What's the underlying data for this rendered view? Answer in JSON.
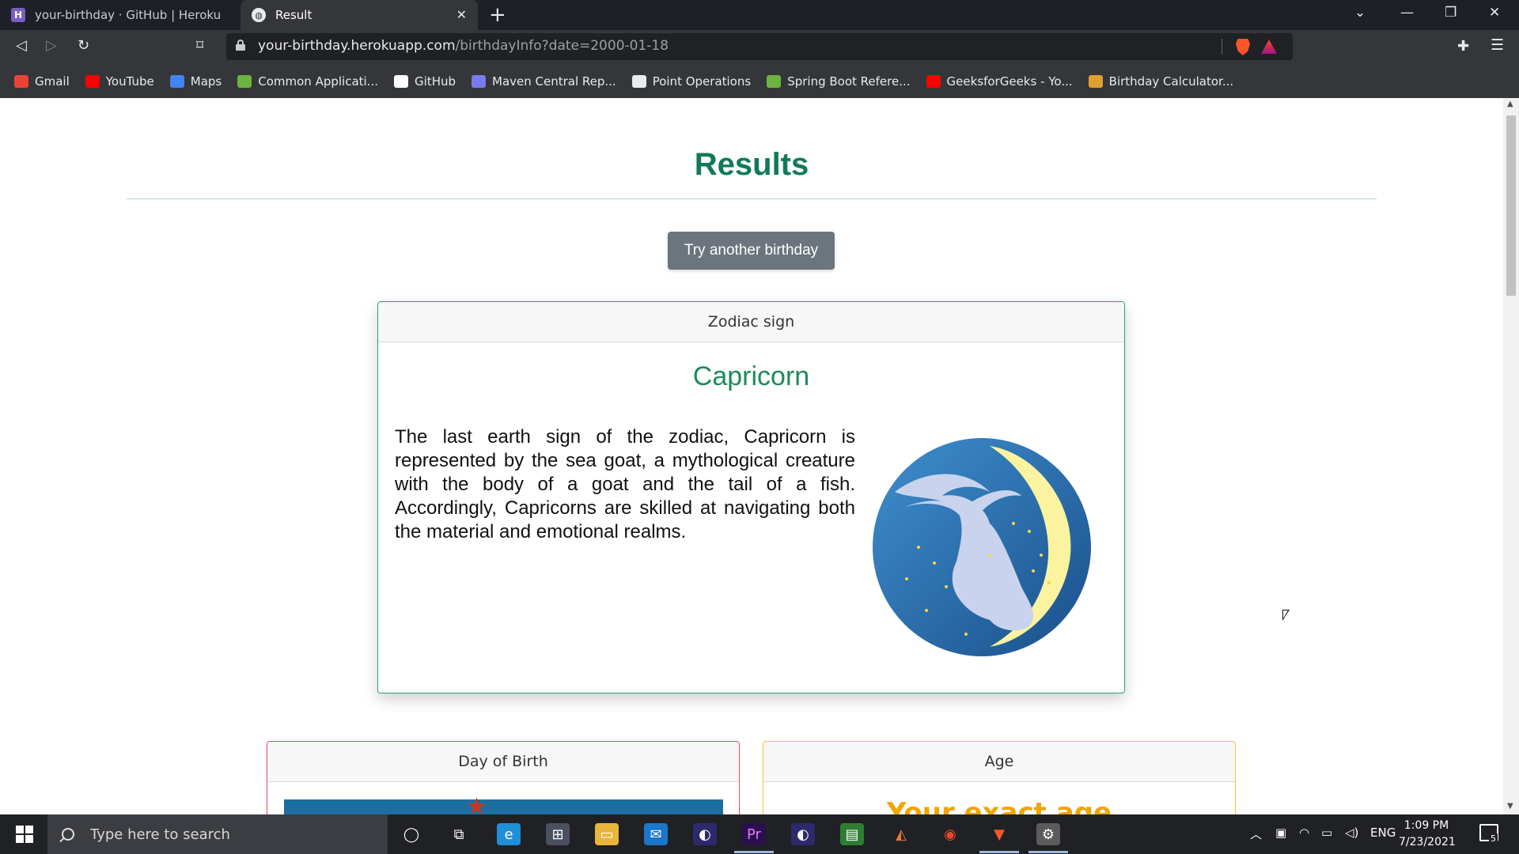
{
  "browser": {
    "tabs": [
      {
        "title": "your-birthday · GitHub | Heroku",
        "active": false
      },
      {
        "title": "Result",
        "active": true
      }
    ],
    "url_host": "your-birthday.herokuapp.com",
    "url_path": "/birthdayInfo?date=2000-01-18",
    "bookmarks": [
      {
        "label": "Gmail",
        "icon": "gmail-icon",
        "color": "#ea4335"
      },
      {
        "label": "YouTube",
        "icon": "youtube-icon",
        "color": "#ff0000"
      },
      {
        "label": "Maps",
        "icon": "maps-icon",
        "color": "#4285f4"
      },
      {
        "label": "Common Applicati...",
        "icon": "leaf-icon",
        "color": "#6db33f"
      },
      {
        "label": "GitHub",
        "icon": "github-icon",
        "color": "#ffffff"
      },
      {
        "label": "Maven Central Rep...",
        "icon": "maven-icon",
        "color": "#7a7af0"
      },
      {
        "label": "Point Operations",
        "icon": "document-icon",
        "color": "#e8eaed"
      },
      {
        "label": "Spring Boot Refere...",
        "icon": "spring-icon",
        "color": "#6db33f"
      },
      {
        "label": "GeeksforGeeks - Yo...",
        "icon": "youtube-icon",
        "color": "#ff0000"
      },
      {
        "label": "Birthday Calculator...",
        "icon": "calculator-icon",
        "color": "#e0a030"
      }
    ]
  },
  "page": {
    "title": "Results",
    "try_button": "Try another birthday",
    "zodiac": {
      "header": "Zodiac sign",
      "name": "Capricorn",
      "description": "The last earth sign of the zodiac, Capricorn is represented by the sea goat, a mythological creature with the body of a goat and the tail of a fish. Accordingly, Capricorns are skilled at navigating both the material and emotional realms.",
      "image_icon": "capricorn-goat-icon"
    },
    "day_card": {
      "header": "Day of Birth"
    },
    "age_card": {
      "header": "Age",
      "partial_text": "Your exact age"
    }
  },
  "taskbar": {
    "search_placeholder": "Type here to search",
    "language": "ENG",
    "time": "1:09 PM",
    "date": "7/23/2021",
    "notification_count": "5"
  },
  "colors": {
    "accent_green": "#107b54",
    "zodiac_border": "#27a072",
    "day_border": "#e04a5c",
    "age_border": "#f2c43a",
    "button_gray": "#6c757d"
  }
}
